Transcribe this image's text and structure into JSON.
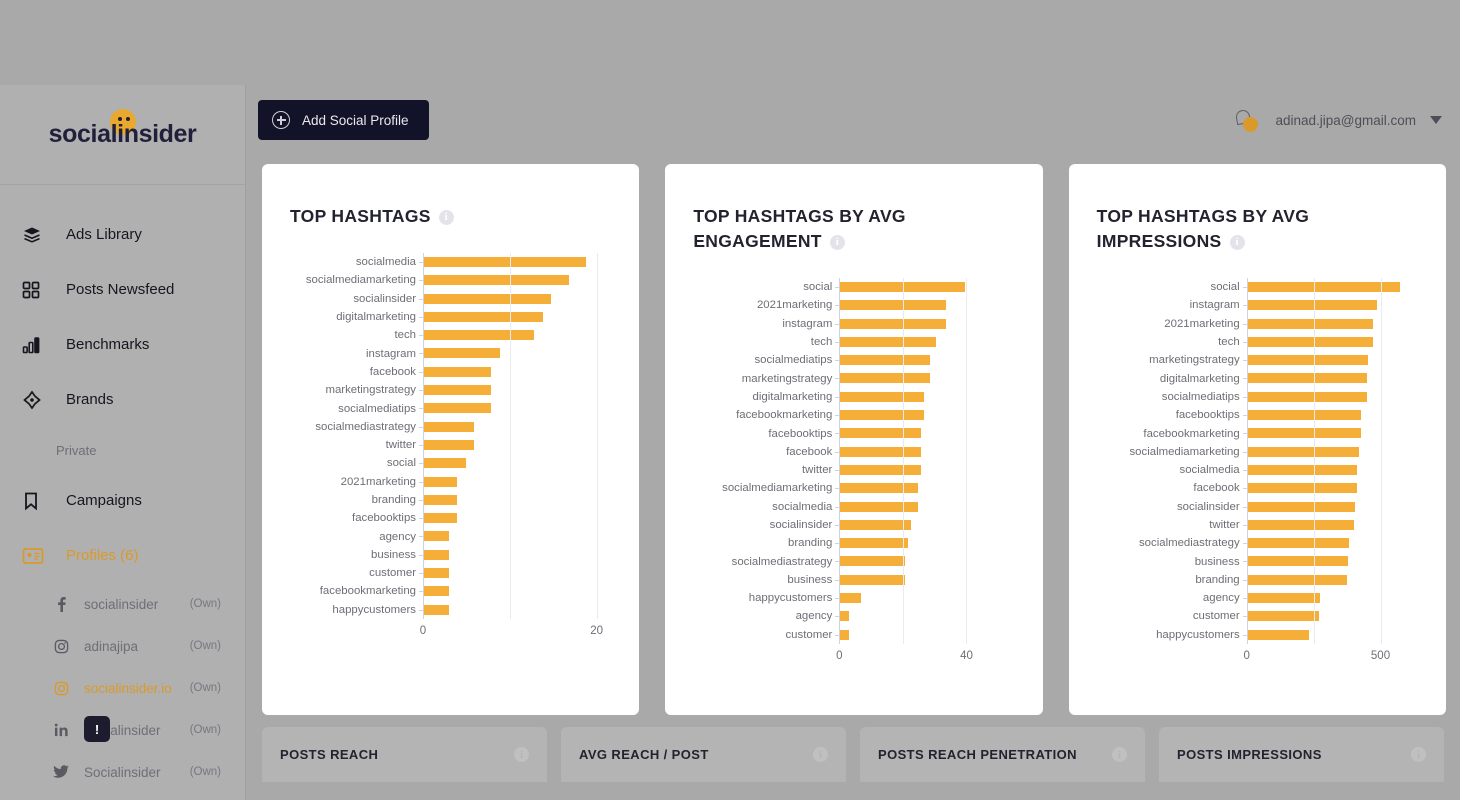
{
  "brand": {
    "name": "socialinsider"
  },
  "topbar": {
    "add_profile_label": "Add Social Profile",
    "user_email": "adinad.jipa@gmail.com"
  },
  "sidebar": {
    "items": [
      {
        "label": "Ads Library",
        "icon": "layers-icon",
        "active": false
      },
      {
        "label": "Posts Newsfeed",
        "icon": "grid-icon",
        "active": false
      },
      {
        "label": "Benchmarks",
        "icon": "bar-chart-icon",
        "active": false
      },
      {
        "label": "Brands",
        "icon": "diamond-icon",
        "active": false
      }
    ],
    "section_label": "Private",
    "campaigns": {
      "label": "Campaigns",
      "icon": "bookmark-icon"
    },
    "profiles": {
      "label": "Profiles (6)",
      "icon": "id-card-icon",
      "active": true
    },
    "profile_list": [
      {
        "name": "socialinsider",
        "network": "facebook",
        "glyph": "f",
        "ownership": "(Own)",
        "active": false
      },
      {
        "name": "adinajipa",
        "network": "instagram",
        "glyph": "▢",
        "ownership": "(Own)",
        "active": false
      },
      {
        "name": "socialinsider.io",
        "network": "instagram",
        "glyph": "▢",
        "ownership": "(Own)",
        "active": true
      },
      {
        "name": "Socialinsider",
        "network": "linkedin",
        "glyph": "in",
        "ownership": "(Own)",
        "active": false,
        "badge": "!"
      },
      {
        "name": "Socialinsider",
        "network": "twitter",
        "glyph": "ᵛ",
        "ownership": "(Own)",
        "active": false
      }
    ]
  },
  "bottom_cards": [
    {
      "title": "POSTS REACH",
      "icon": "info-icon"
    },
    {
      "title": "AVG REACH / POST",
      "icon": "info-icon"
    },
    {
      "title": "POSTS REACH PENETRATION",
      "icon": "info-icon"
    },
    {
      "title": "POSTS IMPRESSIONS",
      "icon": "info-icon"
    }
  ],
  "chart_data": [
    {
      "type": "bar",
      "orientation": "horizontal",
      "title": "TOP HASHTAGS",
      "xlabel": "",
      "ylabel": "",
      "xlim": [
        0,
        22
      ],
      "ticks": [
        0,
        20
      ],
      "tick_labels": [
        "0",
        "20"
      ],
      "grid": true,
      "bar_color": "#f5ae38",
      "categories": [
        "socialmedia",
        "socialmediamarketing",
        "socialinsider",
        "digitalmarketing",
        "tech",
        "instagram",
        "facebook",
        "marketingstrategy",
        "socialmediatips",
        "socialmediastrategy",
        "twitter",
        "social",
        "2021marketing",
        "branding",
        "facebooktips",
        "agency",
        "business",
        "customer",
        "facebookmarketing",
        "happycustomers"
      ],
      "values": [
        19,
        17,
        15,
        14,
        13,
        9,
        8,
        8,
        8,
        6,
        6,
        5,
        4,
        4,
        4,
        3,
        3,
        3,
        3,
        3
      ]
    },
    {
      "type": "bar",
      "orientation": "horizontal",
      "title": "TOP HASHTAGS BY AVG ENGAGEMENT",
      "xlabel": "",
      "ylabel": "",
      "xlim": [
        0,
        56
      ],
      "ticks": [
        0,
        40
      ],
      "tick_labels": [
        "0",
        "40"
      ],
      "grid": true,
      "bar_color": "#f5ae38",
      "categories": [
        "social",
        "2021marketing",
        "instagram",
        "tech",
        "socialmediatips",
        "marketingstrategy",
        "digitalmarketing",
        "facebookmarketing",
        "facebooktips",
        "facebook",
        "twitter",
        "socialmediamarketing",
        "socialmedia",
        "socialinsider",
        "branding",
        "socialmediastrategy",
        "business",
        "happycustomers",
        "agency",
        "customer"
      ],
      "values": [
        40,
        34,
        34,
        31,
        29,
        29,
        27,
        27,
        26,
        26,
        26,
        25,
        25,
        23,
        22,
        21,
        21,
        7,
        3,
        3
      ]
    },
    {
      "type": "bar",
      "orientation": "horizontal",
      "title": "TOP HASHTAGS BY AVG IMPRESSIONS",
      "xlabel": "",
      "ylabel": "",
      "xlim": [
        0,
        650
      ],
      "ticks": [
        0,
        500
      ],
      "tick_labels": [
        "0",
        "500"
      ],
      "grid": true,
      "bar_color": "#f5ae38",
      "categories": [
        "social",
        "instagram",
        "2021marketing",
        "tech",
        "marketingstrategy",
        "digitalmarketing",
        "socialmediatips",
        "facebooktips",
        "facebookmarketing",
        "socialmediamarketing",
        "socialmedia",
        "facebook",
        "socialinsider",
        "twitter",
        "socialmediastrategy",
        "business",
        "branding",
        "agency",
        "customer",
        "happycustomers"
      ],
      "values": [
        580,
        495,
        480,
        478,
        460,
        455,
        455,
        435,
        433,
        425,
        420,
        420,
        412,
        408,
        390,
        385,
        380,
        278,
        275,
        235
      ]
    }
  ]
}
